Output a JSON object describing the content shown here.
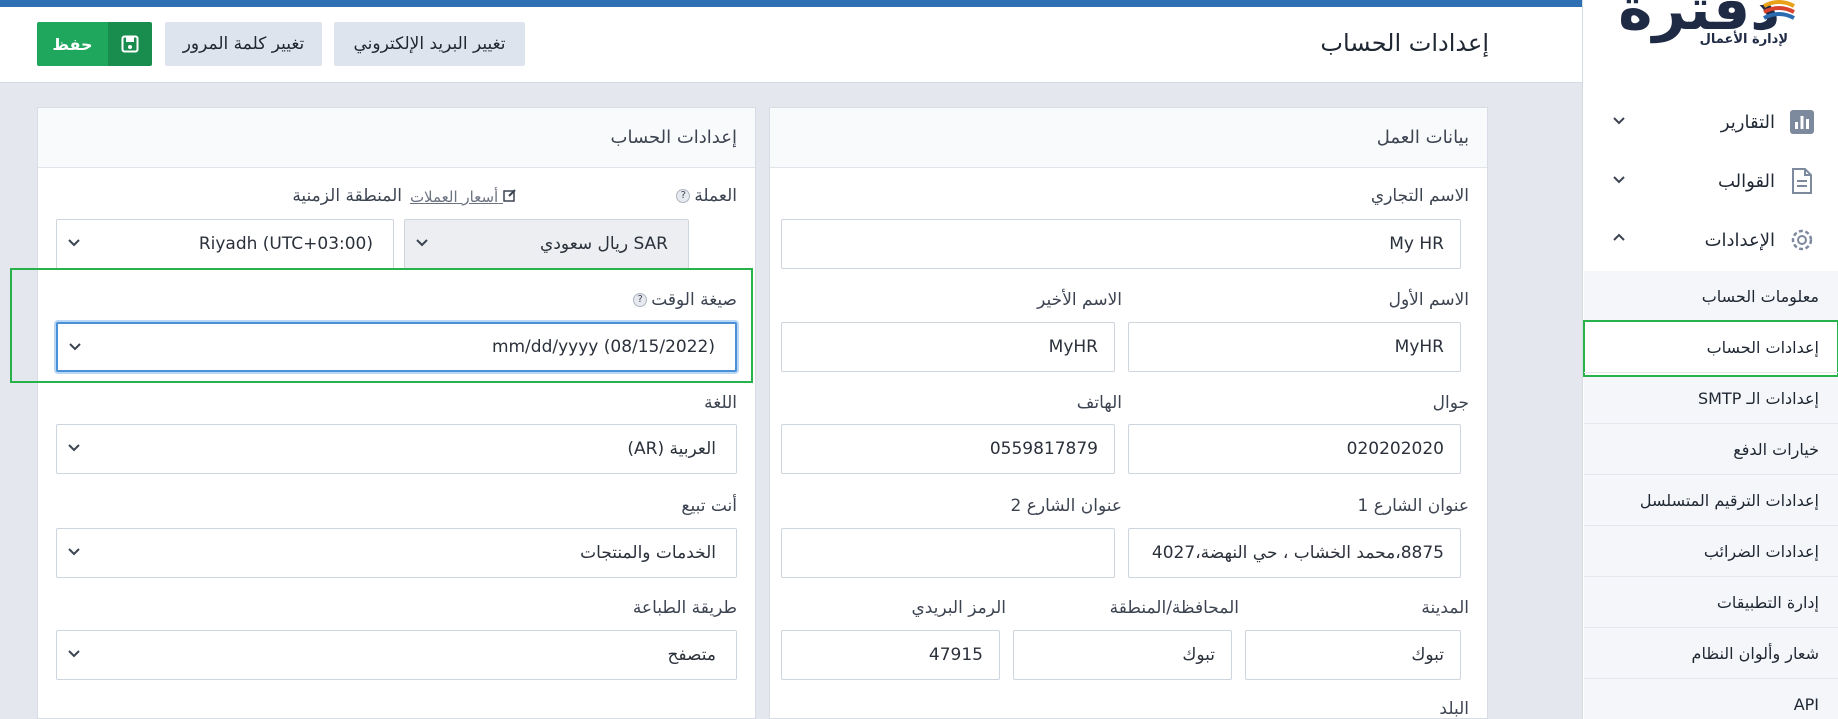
{
  "header": {
    "title": "إعدادات الحساب",
    "save_label": "حفظ",
    "change_password_label": "تغيير كلمة المرور",
    "change_email_label": "تغيير البريد الإلكتروني"
  },
  "sidebar": {
    "logo_text": "دفترة",
    "logo_sub": "لإدارة الأعمال",
    "nav": [
      {
        "label": "التقارير",
        "icon": "bar-chart-icon"
      },
      {
        "label": "القوالب",
        "icon": "document-icon"
      },
      {
        "label": "الإعدادات",
        "icon": "gear-icon"
      }
    ],
    "submenu": [
      "معلومات الحساب",
      "إعدادات الحساب",
      "إعدادات الـ SMTP",
      "خيارات الدفع",
      "إعدادات الترقيم المتسلسل",
      "إعدادات الضرائب",
      "إدارة التطبيقات",
      "شعار وألوان النظام",
      "API"
    ],
    "active_submenu": "إعدادات الحساب"
  },
  "business": {
    "title": "بيانات العمل",
    "trade_name_label": "الاسم التجاري",
    "trade_name": "My HR",
    "first_name_label": "الاسم الأول",
    "first_name": "MyHR",
    "last_name_label": "الاسم الأخير",
    "last_name": "MyHR",
    "mobile_label": "جوال",
    "mobile": "020202020",
    "phone_label": "الهاتف",
    "phone": "0559817879",
    "street1_label": "عنوان الشارع 1",
    "street1": "8875،محمد الخشاب ، حي النهضة،4027",
    "street2_label": "عنوان الشارع 2",
    "street2": "",
    "city_label": "المدينة",
    "city": "تبوك",
    "region_label": "المحافظة/المنطقة",
    "region": "تبوك",
    "postal_label": "الرمز البريدي",
    "postal": "47915",
    "country_label": "البلد"
  },
  "account": {
    "title": "إعدادات الحساب",
    "currency_label": "العملة",
    "currency_rates_link": "أسعار العملات",
    "currency": "SAR ريال سعودي",
    "timezone_label": "المنطقة الزمنية",
    "timezone": "Riyadh (UTC+03:00)",
    "time_format_label": "صيغة الوقت",
    "time_format": "mm/dd/yyyy (08/15/2022)",
    "language_label": "اللغة",
    "language": "العربية (AR)",
    "you_sell_label": "أنت تبيع",
    "you_sell": "الخدمات والمنتجات",
    "print_method_label": "طريقة الطباعة",
    "print_method": "متصفح"
  },
  "colors": {
    "accent_bar": "#2f6fb3",
    "save_green": "#1fa85d",
    "highlight_green": "#27b34a"
  }
}
